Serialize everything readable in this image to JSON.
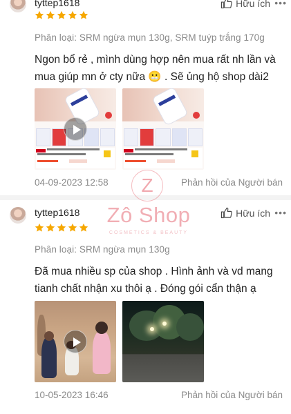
{
  "reviews": [
    {
      "username": "tyttep1618",
      "stars": 5,
      "variant": "Phân loại: SRM ngừa mụn 130g, SRM tuýp trắng 170g",
      "comment": "Ngon bổ rẻ , mình dùng hợp nên mua rất nh lần và mua giúp mn ở cty nữa 😬 . Sẽ ủng hộ shop dài2",
      "date": "04-09-2023 12:58",
      "helpful": "Hữu ích",
      "reply": "Phản hồi của Người bán",
      "media": [
        {
          "type": "video",
          "thumbnail": "product-ad"
        },
        {
          "type": "image",
          "thumbnail": "product-ad"
        }
      ]
    },
    {
      "username": "tyttep1618",
      "stars": 5,
      "variant": "Phân loại: SRM ngừa mụn 130g",
      "comment": "Đã mua nhiều sp của shop . Hình ảnh và vd mang tianh chất nhận xu thôi ạ . Đóng gói cẩn thận ạ",
      "date": "10-05-2023 16:46",
      "helpful": "Hữu ích",
      "reply": "Phản hồi của Người bán",
      "media": [
        {
          "type": "video",
          "thumbnail": "kids-photo"
        },
        {
          "type": "image",
          "thumbnail": "night-street"
        }
      ]
    }
  ],
  "more_icon": "•••",
  "watermark": {
    "logo_letter": "Z",
    "name": "Zô Shop",
    "tagline": "COSMETICS & BEAUTY"
  },
  "colors": {
    "star": "#f6a700",
    "muted_text": "#8a8a8a",
    "watermark": "#e8787f"
  }
}
